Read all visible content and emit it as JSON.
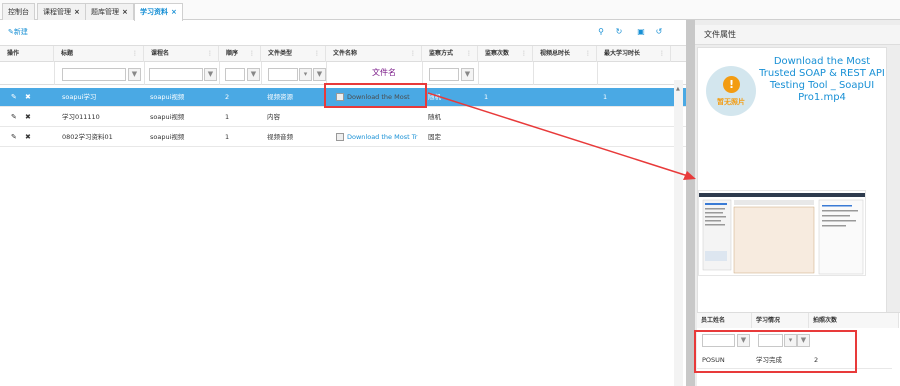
{
  "tabs": [
    {
      "label": "控制台",
      "closable": false
    },
    {
      "label": "课程管理",
      "closable": true
    },
    {
      "label": "题库管理",
      "closable": true
    },
    {
      "label": "学习资料",
      "closable": true,
      "active": true
    }
  ],
  "toolbar": {
    "new_label": "新建",
    "icons": [
      "search-icon",
      "refresh-icon",
      "save-icon",
      "undo-icon"
    ]
  },
  "grid": {
    "columns": [
      "操作",
      "标题",
      "课程名",
      "顺序",
      "文件类型",
      "文件名称",
      "监察方式",
      "监察次数",
      "视频总时长",
      "最大学习时长"
    ],
    "filter_annotation": "文件名",
    "rows": [
      {
        "title": "soapui学习",
        "course": "soapui视频",
        "order": "2",
        "file_type": "视频资源",
        "file_name": "Download the Most",
        "monitor": "随机",
        "count": "1",
        "duration": "",
        "max_duration": "1",
        "selected": true
      },
      {
        "title": "学习011110",
        "course": "soapui视频",
        "order": "1",
        "file_type": "内容",
        "file_name": "",
        "monitor": "随机",
        "count": "",
        "duration": "",
        "max_duration": "",
        "selected": false
      },
      {
        "title": "0802学习资料01",
        "course": "soapui视频",
        "order": "1",
        "file_type": "视频音频",
        "file_name": "Download the Most Tr",
        "monitor": "固定",
        "count": "",
        "duration": "",
        "max_duration": "",
        "selected": false
      }
    ]
  },
  "right_panel": {
    "title": "文件属性",
    "file_title": "Download the Most Trusted SOAP & REST API Testing Tool _ SoapUI Pro1.mp4",
    "no_image_label": "暂无照片",
    "sub_grid": {
      "columns": [
        "员工姓名",
        "学习情况",
        "拍照次数"
      ],
      "rows": [
        {
          "name": "POSUN",
          "status": "学习完成",
          "photos": "2"
        }
      ]
    }
  },
  "colors": {
    "accent": "#1890d5",
    "selected_row": "#4aa9e4",
    "annotation": "#e83a3a"
  }
}
